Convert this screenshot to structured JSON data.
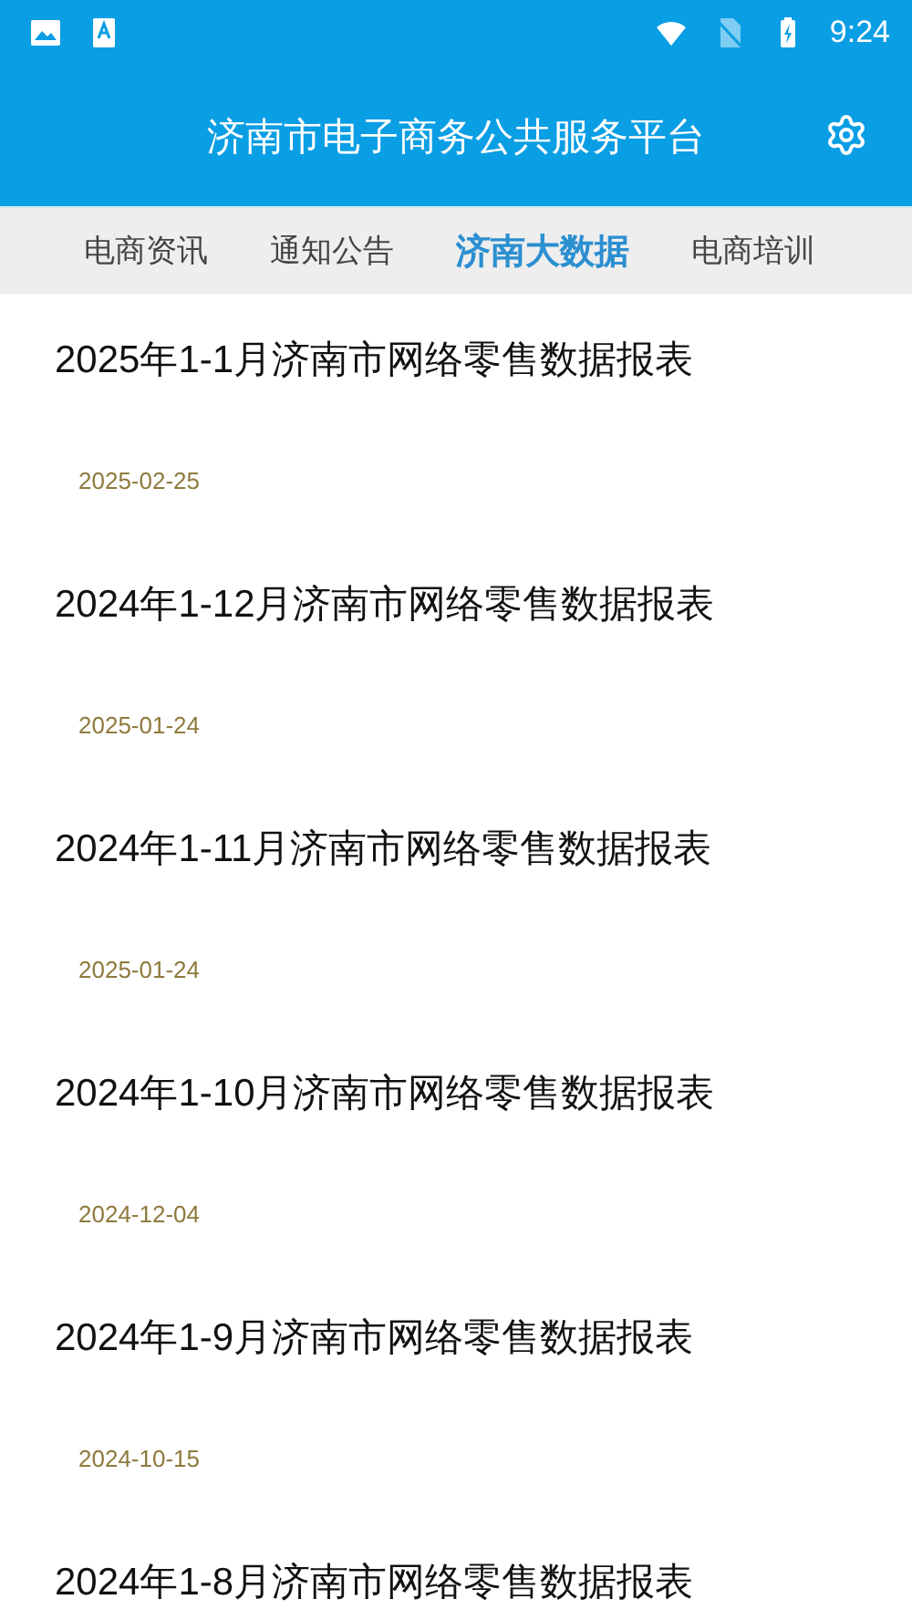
{
  "status_bar": {
    "time": "9:24"
  },
  "app_bar": {
    "title": "济南市电子商务公共服务平台"
  },
  "tabs": [
    {
      "label": "电商资讯",
      "selected": false
    },
    {
      "label": "通知公告",
      "selected": false
    },
    {
      "label": "济南大数据",
      "selected": true
    },
    {
      "label": "电商培训",
      "selected": false
    }
  ],
  "articles": [
    {
      "title": "2025年1-1月济南市网络零售数据报表",
      "date": "2025-02-25"
    },
    {
      "title": "2024年1-12月济南市网络零售数据报表",
      "date": "2025-01-24"
    },
    {
      "title": "2024年1-11月济南市网络零售数据报表",
      "date": "2025-01-24"
    },
    {
      "title": "2024年1-10月济南市网络零售数据报表",
      "date": "2024-12-04"
    },
    {
      "title": "2024年1-9月济南市网络零售数据报表",
      "date": "2024-10-15"
    },
    {
      "title": "2024年1-8月济南市网络零售数据报表"
    }
  ]
}
